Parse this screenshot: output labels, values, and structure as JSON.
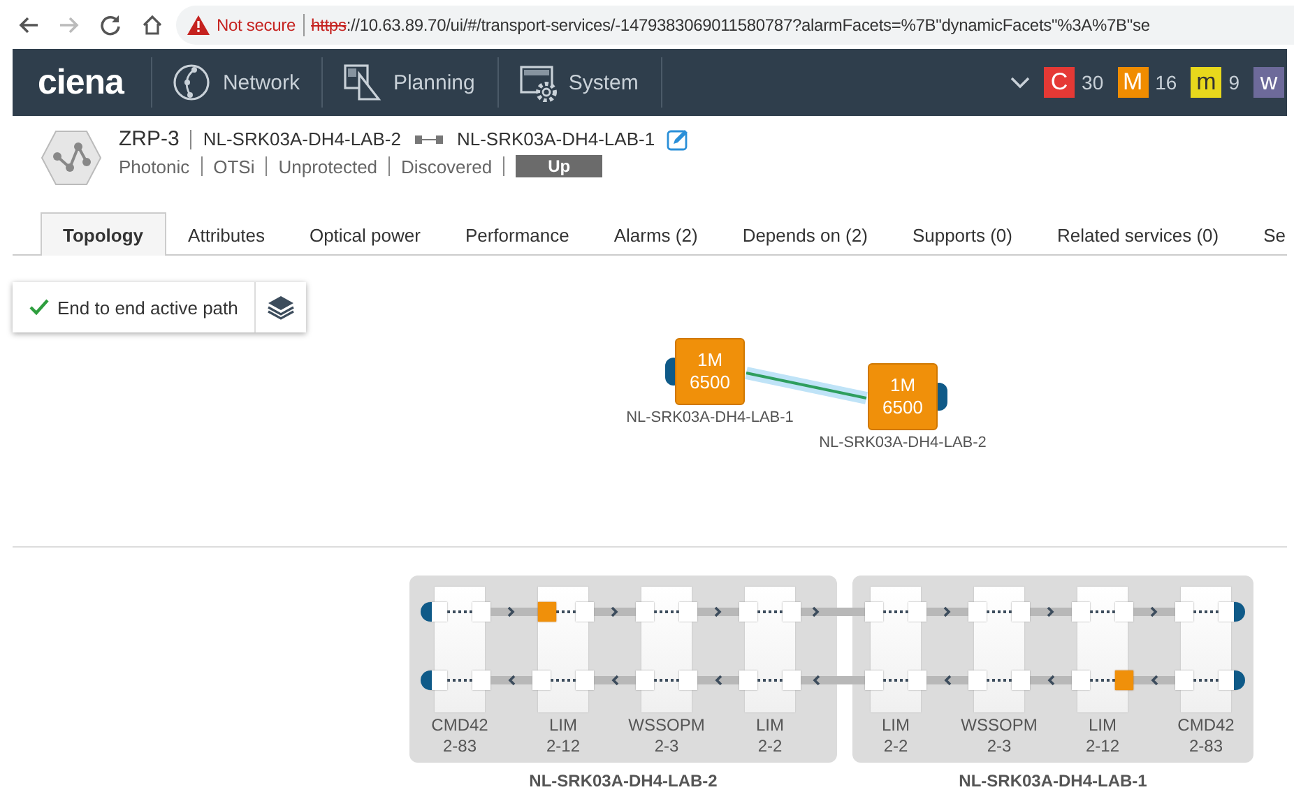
{
  "browser": {
    "security": "Not secure",
    "scheme": "https",
    "url_rest": "://10.63.89.70/ui/#/transport-services/-1479383069011580787?alarmFacets=%7B\"dynamicFacets\"%3A%7B\"se"
  },
  "nav": {
    "logo": "ciena",
    "items": [
      {
        "label": "Network",
        "kind": "network"
      },
      {
        "label": "Planning",
        "kind": "planning"
      },
      {
        "label": "System",
        "kind": "system"
      }
    ],
    "alarms": [
      {
        "letter": "C",
        "count": "30",
        "color": "#e53935"
      },
      {
        "letter": "M",
        "count": "16",
        "color": "#f08c00"
      },
      {
        "letter": "m",
        "count": "9",
        "color": "#e8d81c"
      },
      {
        "letter": "w",
        "color": "#6d6a9a"
      }
    ]
  },
  "service": {
    "name": "ZRP-3",
    "endpoint_a": "NL-SRK03A-DH4-LAB-2",
    "endpoint_b": "NL-SRK03A-DH4-LAB-1",
    "tags": [
      "Photonic",
      "OTSi",
      "Unprotected",
      "Discovered"
    ],
    "status": "Up"
  },
  "tabs": [
    {
      "label": "Topology",
      "selected": true
    },
    {
      "label": "Attributes",
      "selected": false
    },
    {
      "label": "Optical power",
      "selected": false
    },
    {
      "label": "Performance",
      "selected": false
    },
    {
      "label": "Alarms (2)",
      "selected": false
    },
    {
      "label": "Depends on (2)",
      "selected": false
    },
    {
      "label": "Supports (0)",
      "selected": false
    },
    {
      "label": "Related services (0)",
      "selected": false
    },
    {
      "label": "Se",
      "selected": false
    }
  ],
  "toolbar": {
    "path_button": "End to end active path"
  },
  "topology": {
    "nodes": [
      {
        "line1": "1M",
        "line2": "6500",
        "label": "NL-SRK03A-DH4-LAB-1"
      },
      {
        "line1": "1M",
        "line2": "6500",
        "label": "NL-SRK03A-DH4-LAB-2"
      }
    ]
  },
  "shelves": [
    {
      "name": "NL-SRK03A-DH4-LAB-2",
      "cards": [
        {
          "type": "CMD42",
          "slot": "2-83",
          "ports": [
            {
              "alarm": false
            },
            {
              "alarm": false
            },
            {
              "alarm": false
            },
            {
              "alarm": false
            }
          ]
        },
        {
          "type": "LIM",
          "slot": "2-12",
          "ports": [
            {
              "alarm": true
            },
            {
              "alarm": false
            },
            {
              "alarm": false
            },
            {
              "alarm": false
            }
          ]
        },
        {
          "type": "WSSOPM",
          "slot": "2-3",
          "ports": [
            {
              "alarm": false
            },
            {
              "alarm": false
            },
            {
              "alarm": false
            },
            {
              "alarm": false
            }
          ]
        },
        {
          "type": "LIM",
          "slot": "2-2",
          "ports": [
            {
              "alarm": false
            },
            {
              "alarm": false
            },
            {
              "alarm": false
            },
            {
              "alarm": false
            }
          ]
        }
      ]
    },
    {
      "name": "NL-SRK03A-DH4-LAB-1",
      "cards": [
        {
          "type": "LIM",
          "slot": "2-2",
          "ports": [
            {
              "alarm": false
            },
            {
              "alarm": false
            },
            {
              "alarm": false
            },
            {
              "alarm": false
            }
          ]
        },
        {
          "type": "WSSOPM",
          "slot": "2-3",
          "ports": [
            {
              "alarm": false
            },
            {
              "alarm": false
            },
            {
              "alarm": false
            },
            {
              "alarm": false
            }
          ]
        },
        {
          "type": "LIM",
          "slot": "2-12",
          "ports": [
            {
              "alarm": false
            },
            {
              "alarm": false
            },
            {
              "alarm": false
            },
            {
              "alarm": true
            }
          ]
        },
        {
          "type": "CMD42",
          "slot": "2-83",
          "ports": [
            {
              "alarm": false
            },
            {
              "alarm": false
            },
            {
              "alarm": false
            },
            {
              "alarm": false
            }
          ]
        }
      ]
    }
  ]
}
